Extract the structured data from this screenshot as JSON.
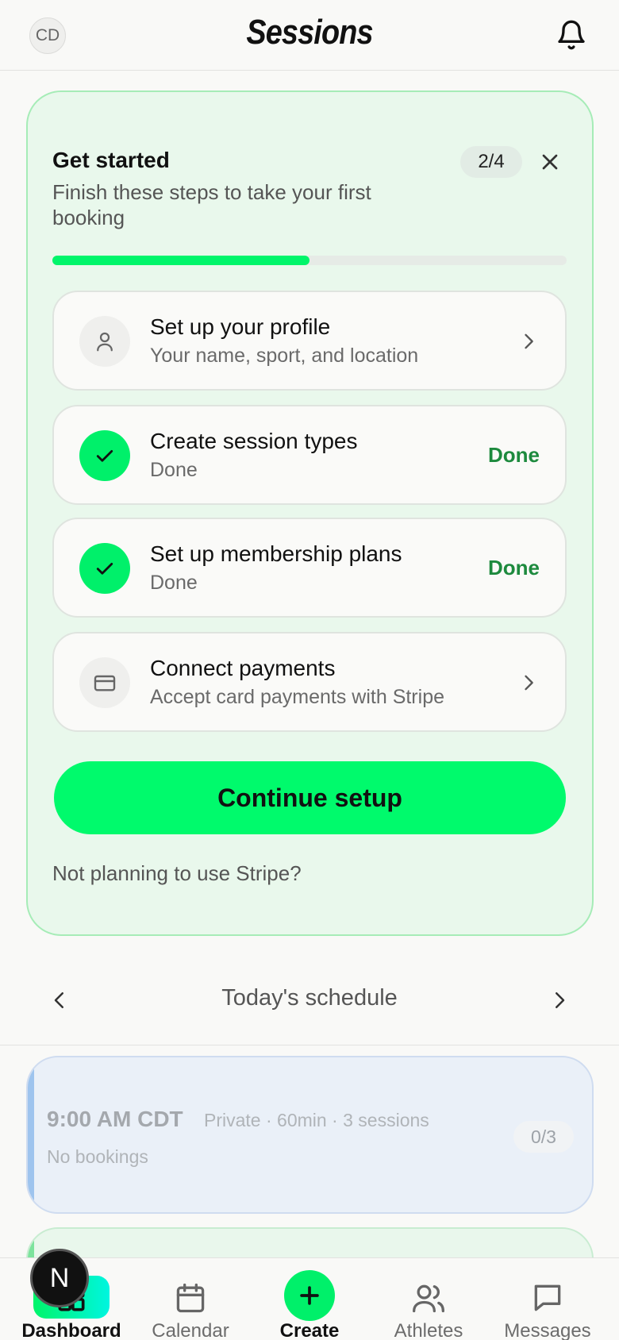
{
  "header": {
    "avatar_initials": "CD",
    "title": "Sessions",
    "bell_icon": "bell-icon"
  },
  "setup": {
    "title": "Get started",
    "subtitle": "Finish these steps to take your first booking",
    "count": "2/4",
    "progress_fraction": 0.5,
    "steps": [
      {
        "title": "Set up your profile",
        "subtitle": "Your name, sport, and location",
        "status": "pending",
        "icon": "user-icon"
      },
      {
        "title": "Create session types",
        "subtitle": "Done",
        "status": "done",
        "done_label": "Done",
        "icon": "check-icon"
      },
      {
        "title": "Set up membership plans",
        "subtitle": "Done",
        "status": "done",
        "done_label": "Done",
        "icon": "check-icon"
      },
      {
        "title": "Connect payments",
        "subtitle": "Accept card payments with Stripe",
        "status": "pending",
        "icon": "credit-card-icon"
      }
    ],
    "continue_label": "Continue setup",
    "stripe_link": "Not planning to use Stripe?"
  },
  "schedule": {
    "title": "Today's schedule",
    "sessions": [
      {
        "time": "9:00 AM CDT",
        "meta": "Private · 60min · 3 sessions",
        "status": "No bookings",
        "count": "0/3"
      }
    ]
  },
  "nav": {
    "items": [
      {
        "label": "Dashboard",
        "icon": "dashboard-icon",
        "active": true
      },
      {
        "label": "Calendar",
        "icon": "calendar-icon",
        "active": false
      },
      {
        "label": "Create",
        "icon": "plus-icon",
        "active": true
      },
      {
        "label": "Athletes",
        "icon": "users-icon",
        "active": false
      },
      {
        "label": "Messages",
        "icon": "message-icon",
        "active": false
      }
    ]
  },
  "dev_badge": "N",
  "colors": {
    "accent": "#00F56A",
    "done_text": "#1D8A3E",
    "card_bg": "#E9F8EC",
    "session_bg": "#EAF0F8"
  }
}
